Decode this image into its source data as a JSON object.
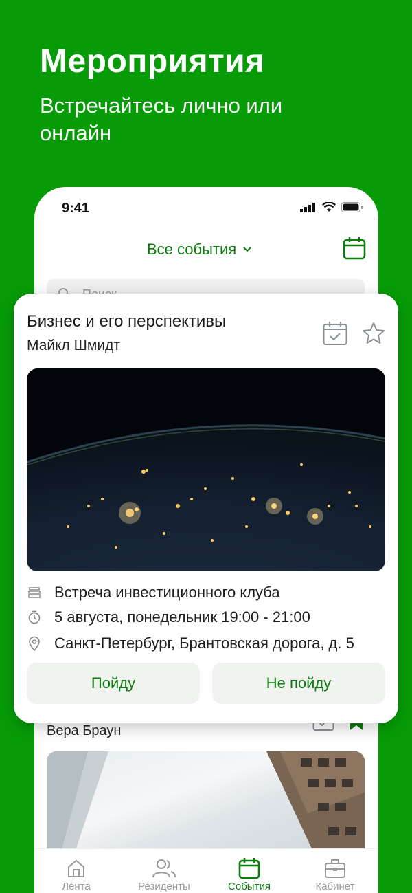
{
  "promo": {
    "title": "Мероприятия",
    "subtitle": "Встречайтесь лично или онлайн"
  },
  "status_bar": {
    "time": "9:41"
  },
  "header": {
    "events_filter": "Все события",
    "calendar_icon": "calendar-icon"
  },
  "search": {
    "placeholder": "Поиск"
  },
  "card": {
    "title": "Бизнес и его перспективы",
    "author": "Майкл Шмидт",
    "image": "earth-at-night-image",
    "type": "Встреча инвестиционного клуба",
    "datetime": "5 августа, понедельник 19:00 - 21:00",
    "location": "Санкт-Петербург, Брантовская дорога, д. 5",
    "go_label": "Пойду",
    "not_go_label": "Не пойду"
  },
  "second_card": {
    "author": "Вера Браун",
    "image": "skyscrapers-image"
  },
  "tabbar": {
    "items": [
      {
        "label": "Лента",
        "icon": "home-icon"
      },
      {
        "label": "Резиденты",
        "icon": "users-icon"
      },
      {
        "label": "События",
        "icon": "calendar-icon",
        "active": true
      },
      {
        "label": "Кабинет",
        "icon": "briefcase-icon"
      }
    ]
  },
  "colors": {
    "brand_green": "#079c07",
    "accent_text": "#0a7d0a"
  }
}
